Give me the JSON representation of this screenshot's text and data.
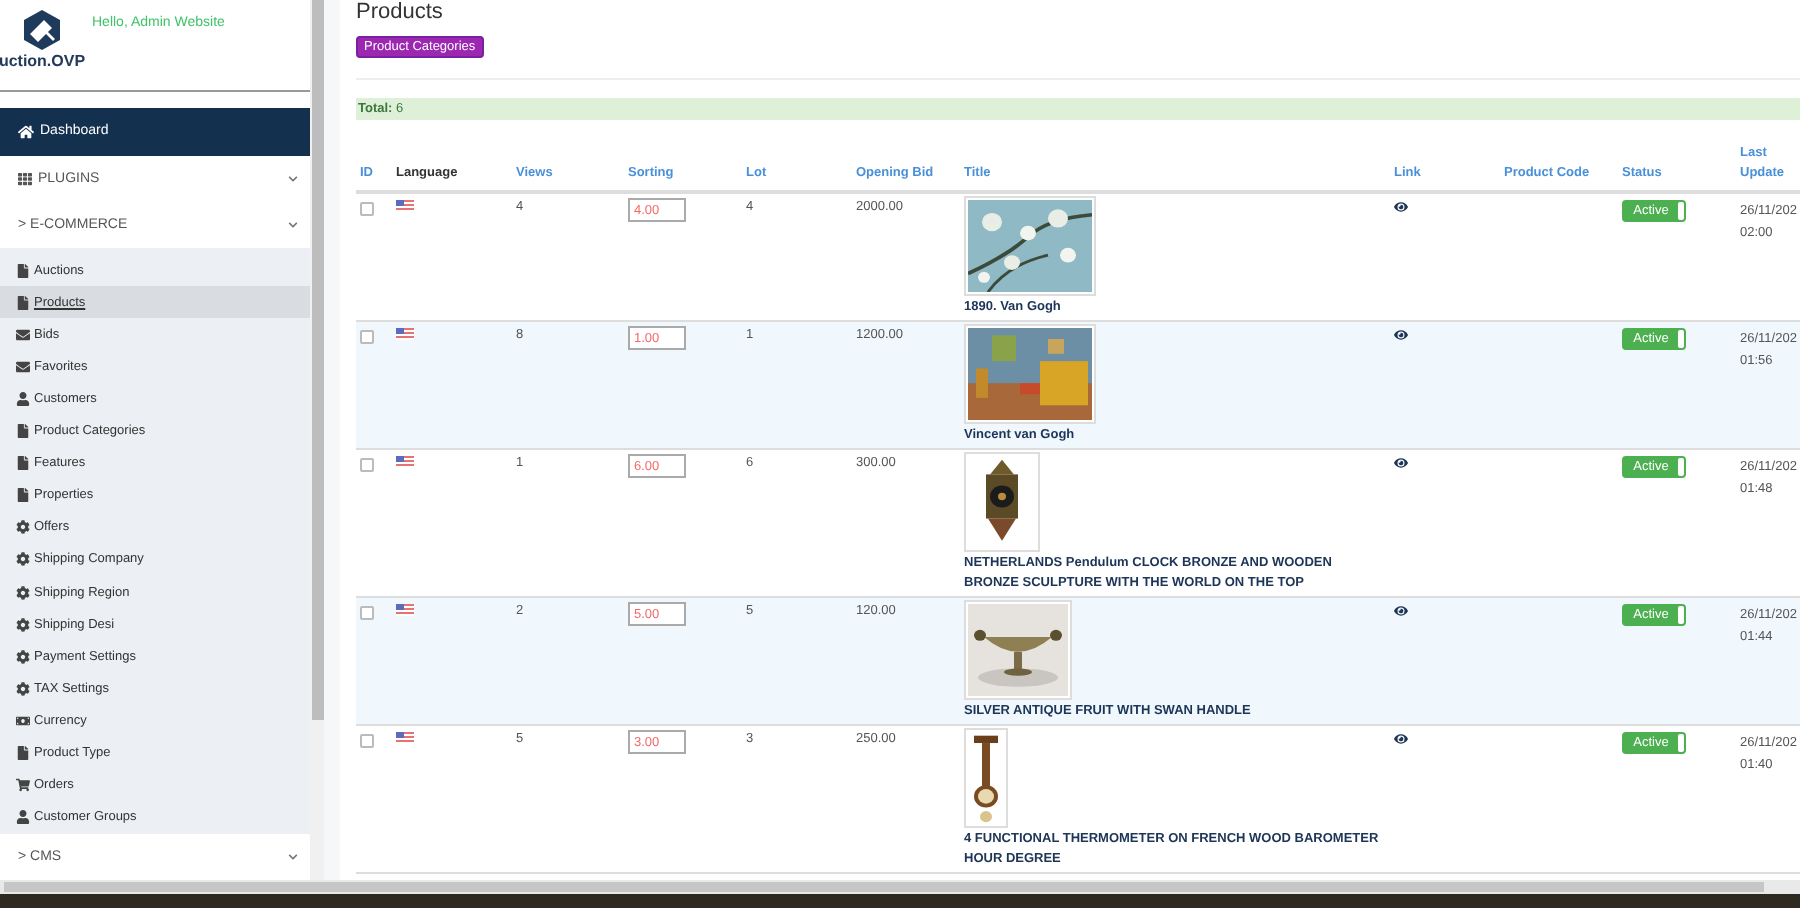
{
  "sidebar": {
    "brand": "uction.OVP",
    "greeting": "Hello, Admin Website",
    "dashboard": "Dashboard",
    "groups": [
      {
        "label": "PLUGINS"
      },
      {
        "label": "E-COMMERCE",
        "prefix": ">"
      }
    ],
    "items": [
      {
        "label": "Auctions",
        "kind": "file",
        "selected": false
      },
      {
        "label": "Products",
        "kind": "file",
        "selected": true
      },
      {
        "label": "Bids",
        "kind": "envelope",
        "selected": false
      },
      {
        "label": "Favorites",
        "kind": "envelope",
        "selected": false
      },
      {
        "label": "Customers",
        "kind": "user",
        "selected": false
      },
      {
        "label": "Product Categories",
        "kind": "file",
        "selected": false
      },
      {
        "label": "Features",
        "kind": "file",
        "selected": false
      },
      {
        "label": "Properties",
        "kind": "file",
        "selected": false
      },
      {
        "label": "Offers",
        "kind": "gear",
        "selected": false
      },
      {
        "label": "Shipping Company",
        "kind": "gear",
        "selected": false
      },
      {
        "label": "Shipping Region",
        "kind": "gear",
        "selected": false
      },
      {
        "label": "Shipping Desi",
        "kind": "gear",
        "selected": false
      },
      {
        "label": "Payment Settings",
        "kind": "gear",
        "selected": false
      },
      {
        "label": "TAX Settings",
        "kind": "gear",
        "selected": false
      },
      {
        "label": "Currency",
        "kind": "money",
        "selected": false
      },
      {
        "label": "Product Type",
        "kind": "file",
        "selected": false
      },
      {
        "label": "Orders",
        "kind": "cart",
        "selected": false
      },
      {
        "label": "Customer Groups",
        "kind": "user",
        "selected": false
      }
    ],
    "footer_group": {
      "label": "CMS",
      "prefix": ">"
    }
  },
  "page": {
    "title": "Products",
    "button": "Product Categories",
    "total": "**Total:** 6"
  },
  "table": {
    "columns": [
      "ID",
      "Language",
      "Views",
      "Sorting",
      "Lot",
      "Opening Bid",
      "Title",
      "Link",
      "Product Code",
      "Status",
      "Last Update"
    ],
    "rows": [
      {
        "checked": false,
        "views": "4",
        "sorting": "4.00",
        "lot": "4",
        "opening_bid": "2000.00",
        "title": "1890. Van Gogh",
        "status": "Active",
        "date": "26/11/202",
        "time": "02:00"
      },
      {
        "checked": false,
        "views": "8",
        "sorting": "1.00",
        "lot": "1",
        "opening_bid": "1200.00",
        "title": "Vincent van Gogh",
        "status": "Active",
        "date": "26/11/202",
        "time": "01:56"
      },
      {
        "checked": false,
        "views": "1",
        "sorting": "6.00",
        "lot": "6",
        "opening_bid": "300.00",
        "title": "NETHERLANDS Pendulum CLOCK BRONZE AND WOODEN BRONZE SCULPTURE WITH THE WORLD ON THE TOP",
        "status": "Active",
        "date": "26/11/202",
        "time": "01:48"
      },
      {
        "checked": false,
        "views": "2",
        "sorting": "5.00",
        "lot": "5",
        "opening_bid": "120.00",
        "title": "SILVER ANTIQUE FRUIT WITH SWAN HANDLE",
        "status": "Active",
        "date": "26/11/202",
        "time": "01:44"
      },
      {
        "checked": false,
        "views": "5",
        "sorting": "3.00",
        "lot": "3",
        "opening_bid": "250.00",
        "title": "4 FUNCTIONAL THERMOMETER ON FRENCH WOOD BAROMETER HOUR DEGREE",
        "status": "Active",
        "date": "26/11/202",
        "time": "01:40"
      }
    ]
  }
}
